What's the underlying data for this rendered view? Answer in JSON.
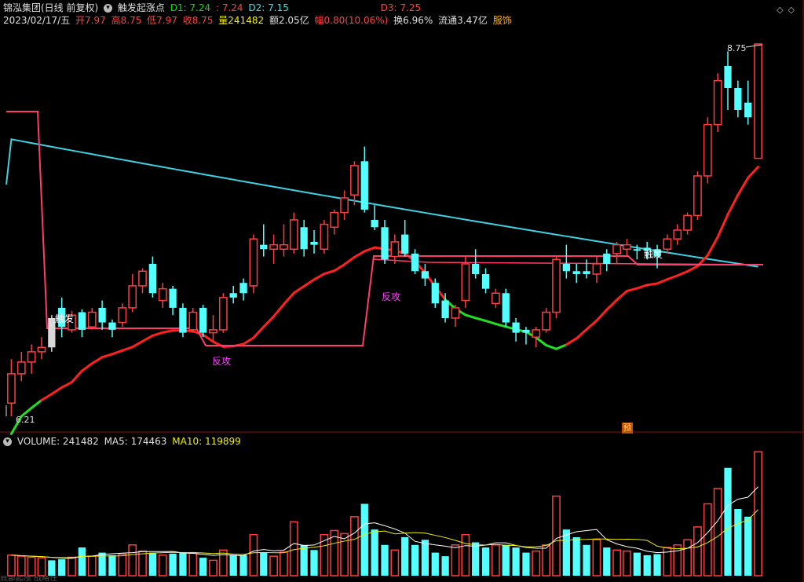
{
  "header": {
    "stock_name": "锦泓集团(日线 前复权)",
    "indicator_name": "触发起涨点",
    "d1_label": "D1: 7.24",
    "d1_extra": ": 7.24",
    "d2_label": "D2: 7.15",
    "d3_label": "D3: 7.25"
  },
  "quote": {
    "date": "2023/02/17/五",
    "open": "开7.97",
    "high": "高8.75",
    "low": "低7.97",
    "close": "收8.75",
    "volume": "量241482",
    "amount": "额2.05亿",
    "change": "幅0.80(10.06%)",
    "turnover": "换6.96%",
    "float": "流通3.47亿",
    "sector": "服饰"
  },
  "volume_header": {
    "label": "VOLUME: 241482",
    "ma5": "MA5: 174463",
    "ma10": "MA10: 119899"
  },
  "chart_labels": {
    "price_high": "8.75",
    "price_low": "6.21",
    "trigger1": "触发",
    "trigger2": "触发",
    "rebound1": "反攻",
    "rebound2": "反攻",
    "forecast_badge": "预"
  },
  "bottom_cut_text": "底部起涨 战略性",
  "colors": {
    "up": "#ff3c3c",
    "down": "#54ffff",
    "ma_long": "#40d0e0",
    "support_red": "#ff2020",
    "support_green": "#20e020",
    "trigger_line": "#ff3c6c",
    "vol_ma5": "#ffffff",
    "vol_ma10": "#f0f000"
  },
  "chart_data": {
    "type": "candlestick",
    "dates_shown": [
      "2023/02/17"
    ],
    "price_range": [
      6.21,
      8.75
    ],
    "candles": [
      {
        "o": 6.3,
        "h": 6.6,
        "l": 6.21,
        "c": 6.5,
        "up": true
      },
      {
        "o": 6.5,
        "h": 6.65,
        "l": 6.45,
        "c": 6.58,
        "up": true
      },
      {
        "o": 6.58,
        "h": 6.7,
        "l": 6.5,
        "c": 6.65,
        "up": true
      },
      {
        "o": 6.65,
        "h": 6.75,
        "l": 6.6,
        "c": 6.68,
        "up": true
      },
      {
        "o": 6.68,
        "h": 6.9,
        "l": 6.65,
        "c": 6.88,
        "up": false,
        "special": true
      },
      {
        "o": 6.95,
        "h": 7.02,
        "l": 6.75,
        "c": 6.82,
        "up": false
      },
      {
        "o": 6.8,
        "h": 6.93,
        "l": 6.78,
        "c": 6.9,
        "up": true
      },
      {
        "o": 6.92,
        "h": 6.94,
        "l": 6.75,
        "c": 6.8,
        "up": false
      },
      {
        "o": 6.82,
        "h": 6.95,
        "l": 6.8,
        "c": 6.92,
        "up": true
      },
      {
        "o": 6.95,
        "h": 7.0,
        "l": 6.8,
        "c": 6.85,
        "up": false
      },
      {
        "o": 6.85,
        "h": 6.87,
        "l": 6.75,
        "c": 6.8,
        "up": false
      },
      {
        "o": 6.85,
        "h": 6.98,
        "l": 6.82,
        "c": 6.95,
        "up": true
      },
      {
        "o": 6.95,
        "h": 7.18,
        "l": 6.92,
        "c": 7.1,
        "up": true
      },
      {
        "o": 7.1,
        "h": 7.22,
        "l": 7.05,
        "c": 7.2,
        "up": true
      },
      {
        "o": 7.25,
        "h": 7.3,
        "l": 7.02,
        "c": 7.05,
        "up": false
      },
      {
        "o": 7.0,
        "h": 7.12,
        "l": 6.95,
        "c": 7.08,
        "up": true
      },
      {
        "o": 7.08,
        "h": 7.1,
        "l": 6.9,
        "c": 6.95,
        "up": false
      },
      {
        "o": 6.95,
        "h": 6.98,
        "l": 6.75,
        "c": 6.78,
        "up": false
      },
      {
        "o": 6.8,
        "h": 6.95,
        "l": 6.78,
        "c": 6.92,
        "up": true
      },
      {
        "o": 6.95,
        "h": 6.97,
        "l": 6.75,
        "c": 6.78,
        "up": false
      },
      {
        "o": 6.78,
        "h": 6.9,
        "l": 6.72,
        "c": 6.8,
        "up": true
      },
      {
        "o": 6.8,
        "h": 7.05,
        "l": 6.78,
        "c": 7.02,
        "up": true
      },
      {
        "o": 7.02,
        "h": 7.1,
        "l": 6.98,
        "c": 7.05,
        "up": false
      },
      {
        "o": 7.05,
        "h": 7.15,
        "l": 7.0,
        "c": 7.12,
        "up": false
      },
      {
        "o": 7.1,
        "h": 7.45,
        "l": 7.05,
        "c": 7.42,
        "up": true
      },
      {
        "o": 7.38,
        "h": 7.52,
        "l": 7.3,
        "c": 7.35,
        "up": false
      },
      {
        "o": 7.35,
        "h": 7.45,
        "l": 7.25,
        "c": 7.38,
        "up": true
      },
      {
        "o": 7.38,
        "h": 7.52,
        "l": 7.3,
        "c": 7.35,
        "up": true
      },
      {
        "o": 7.35,
        "h": 7.6,
        "l": 7.32,
        "c": 7.55,
        "up": true
      },
      {
        "o": 7.5,
        "h": 7.55,
        "l": 7.3,
        "c": 7.35,
        "up": false
      },
      {
        "o": 7.4,
        "h": 7.48,
        "l": 7.32,
        "c": 7.38,
        "up": false
      },
      {
        "o": 7.35,
        "h": 7.55,
        "l": 7.32,
        "c": 7.52,
        "up": true
      },
      {
        "o": 7.5,
        "h": 7.62,
        "l": 7.45,
        "c": 7.6,
        "up": true
      },
      {
        "o": 7.6,
        "h": 7.75,
        "l": 7.55,
        "c": 7.7,
        "up": true
      },
      {
        "o": 7.72,
        "h": 7.95,
        "l": 7.65,
        "c": 7.92,
        "up": true
      },
      {
        "o": 7.95,
        "h": 8.05,
        "l": 7.6,
        "c": 7.62,
        "up": false
      },
      {
        "o": 7.55,
        "h": 7.65,
        "l": 7.48,
        "c": 7.5,
        "up": false
      },
      {
        "o": 7.5,
        "h": 7.55,
        "l": 7.25,
        "c": 7.28,
        "up": false
      },
      {
        "o": 7.3,
        "h": 7.45,
        "l": 7.25,
        "c": 7.4,
        "up": true
      },
      {
        "o": 7.45,
        "h": 7.55,
        "l": 7.3,
        "c": 7.32,
        "up": false
      },
      {
        "o": 7.32,
        "h": 7.35,
        "l": 7.18,
        "c": 7.2,
        "up": false
      },
      {
        "o": 7.2,
        "h": 7.25,
        "l": 7.1,
        "c": 7.15,
        "up": false
      },
      {
        "o": 7.12,
        "h": 7.15,
        "l": 6.95,
        "c": 6.98,
        "up": false
      },
      {
        "o": 7.0,
        "h": 7.05,
        "l": 6.85,
        "c": 6.88,
        "up": false
      },
      {
        "o": 6.88,
        "h": 6.97,
        "l": 6.82,
        "c": 6.95,
        "up": true
      },
      {
        "o": 7.0,
        "h": 7.3,
        "l": 6.95,
        "c": 7.25,
        "up": true
      },
      {
        "o": 7.25,
        "h": 7.35,
        "l": 7.15,
        "c": 7.18,
        "up": false
      },
      {
        "o": 7.18,
        "h": 7.22,
        "l": 7.05,
        "c": 7.08,
        "up": false
      },
      {
        "o": 7.05,
        "h": 7.08,
        "l": 6.95,
        "c": 6.98,
        "up": true
      },
      {
        "o": 7.05,
        "h": 7.08,
        "l": 6.82,
        "c": 6.85,
        "up": false
      },
      {
        "o": 6.85,
        "h": 6.88,
        "l": 6.72,
        "c": 6.78,
        "up": false
      },
      {
        "o": 6.78,
        "h": 6.82,
        "l": 6.7,
        "c": 6.8,
        "up": false
      },
      {
        "o": 6.75,
        "h": 6.82,
        "l": 6.68,
        "c": 6.8,
        "up": true
      },
      {
        "o": 6.8,
        "h": 6.95,
        "l": 6.78,
        "c": 6.92,
        "up": true
      },
      {
        "o": 6.92,
        "h": 7.3,
        "l": 6.88,
        "c": 7.28,
        "up": true
      },
      {
        "o": 7.25,
        "h": 7.38,
        "l": 7.15,
        "c": 7.2,
        "up": false
      },
      {
        "o": 7.18,
        "h": 7.25,
        "l": 7.12,
        "c": 7.2,
        "up": false
      },
      {
        "o": 7.2,
        "h": 7.28,
        "l": 7.15,
        "c": 7.18,
        "up": false
      },
      {
        "o": 7.18,
        "h": 7.3,
        "l": 7.12,
        "c": 7.25,
        "up": true
      },
      {
        "o": 7.25,
        "h": 7.35,
        "l": 7.2,
        "c": 7.32,
        "up": false
      },
      {
        "o": 7.32,
        "h": 7.4,
        "l": 7.25,
        "c": 7.38,
        "up": true
      },
      {
        "o": 7.38,
        "h": 7.42,
        "l": 7.3,
        "c": 7.35,
        "up": true
      },
      {
        "o": 7.35,
        "h": 7.38,
        "l": 7.28,
        "c": 7.34,
        "up": false
      },
      {
        "o": 7.34,
        "h": 7.4,
        "l": 7.28,
        "c": 7.36,
        "up": false
      },
      {
        "o": 7.3,
        "h": 7.38,
        "l": 7.22,
        "c": 7.35,
        "up": false
      },
      {
        "o": 7.35,
        "h": 7.45,
        "l": 7.32,
        "c": 7.42,
        "up": true
      },
      {
        "o": 7.42,
        "h": 7.52,
        "l": 7.38,
        "c": 7.48,
        "up": true
      },
      {
        "o": 7.48,
        "h": 7.6,
        "l": 7.45,
        "c": 7.58,
        "up": true
      },
      {
        "o": 7.58,
        "h": 7.88,
        "l": 7.55,
        "c": 7.85,
        "up": true
      },
      {
        "o": 7.85,
        "h": 8.25,
        "l": 7.8,
        "c": 8.2,
        "up": true
      },
      {
        "o": 8.2,
        "h": 8.55,
        "l": 8.15,
        "c": 8.5,
        "up": true
      },
      {
        "o": 8.6,
        "h": 8.7,
        "l": 8.3,
        "c": 8.45,
        "up": false
      },
      {
        "o": 8.45,
        "h": 8.5,
        "l": 8.25,
        "c": 8.3,
        "up": false
      },
      {
        "o": 8.35,
        "h": 8.5,
        "l": 8.2,
        "c": 8.25,
        "up": false
      },
      {
        "o": 7.97,
        "h": 8.75,
        "l": 7.97,
        "c": 8.75,
        "up": true
      }
    ],
    "volumes": [
      {
        "v": 40000,
        "up": true
      },
      {
        "v": 38000,
        "up": true
      },
      {
        "v": 36000,
        "up": true
      },
      {
        "v": 35000,
        "up": true
      },
      {
        "v": 30000,
        "up": false
      },
      {
        "v": 32000,
        "up": false
      },
      {
        "v": 36000,
        "up": true
      },
      {
        "v": 55000,
        "up": false
      },
      {
        "v": 38000,
        "up": true
      },
      {
        "v": 45000,
        "up": false
      },
      {
        "v": 40000,
        "up": false
      },
      {
        "v": 42000,
        "up": true
      },
      {
        "v": 60000,
        "up": true
      },
      {
        "v": 48000,
        "up": true
      },
      {
        "v": 45000,
        "up": false
      },
      {
        "v": 40000,
        "up": true
      },
      {
        "v": 43000,
        "up": false
      },
      {
        "v": 46000,
        "up": false
      },
      {
        "v": 44000,
        "up": true
      },
      {
        "v": 35000,
        "up": false
      },
      {
        "v": 30000,
        "up": true
      },
      {
        "v": 50000,
        "up": true
      },
      {
        "v": 40000,
        "up": false
      },
      {
        "v": 40000,
        "up": false
      },
      {
        "v": 80000,
        "up": true
      },
      {
        "v": 45000,
        "up": false
      },
      {
        "v": 38000,
        "up": true
      },
      {
        "v": 46000,
        "up": true
      },
      {
        "v": 105000,
        "up": true
      },
      {
        "v": 60000,
        "up": false
      },
      {
        "v": 50000,
        "up": false
      },
      {
        "v": 80000,
        "up": true
      },
      {
        "v": 88000,
        "up": true
      },
      {
        "v": 82000,
        "up": true
      },
      {
        "v": 115000,
        "up": true
      },
      {
        "v": 140000,
        "up": false
      },
      {
        "v": 90000,
        "up": false
      },
      {
        "v": 60000,
        "up": false
      },
      {
        "v": 50000,
        "up": true
      },
      {
        "v": 75000,
        "up": false
      },
      {
        "v": 60000,
        "up": false
      },
      {
        "v": 70000,
        "up": false
      },
      {
        "v": 45000,
        "up": false
      },
      {
        "v": 38000,
        "up": false
      },
      {
        "v": 60000,
        "up": true
      },
      {
        "v": 80000,
        "up": true
      },
      {
        "v": 65000,
        "up": false
      },
      {
        "v": 55000,
        "up": false
      },
      {
        "v": 60000,
        "up": true
      },
      {
        "v": 60000,
        "up": false
      },
      {
        "v": 55000,
        "up": false
      },
      {
        "v": 45000,
        "up": false
      },
      {
        "v": 48000,
        "up": true
      },
      {
        "v": 60000,
        "up": true
      },
      {
        "v": 155000,
        "up": true
      },
      {
        "v": 90000,
        "up": false
      },
      {
        "v": 75000,
        "up": false
      },
      {
        "v": 60000,
        "up": false
      },
      {
        "v": 70000,
        "up": true
      },
      {
        "v": 55000,
        "up": false
      },
      {
        "v": 50000,
        "up": true
      },
      {
        "v": 48000,
        "up": true
      },
      {
        "v": 45000,
        "up": false
      },
      {
        "v": 40000,
        "up": false
      },
      {
        "v": 42000,
        "up": false
      },
      {
        "v": 55000,
        "up": true
      },
      {
        "v": 60000,
        "up": true
      },
      {
        "v": 70000,
        "up": true
      },
      {
        "v": 95000,
        "up": true
      },
      {
        "v": 140000,
        "up": true
      },
      {
        "v": 170000,
        "up": true
      },
      {
        "v": 210000,
        "up": false
      },
      {
        "v": 130000,
        "up": false
      },
      {
        "v": 115000,
        "up": false
      },
      {
        "v": 241482,
        "up": true
      }
    ]
  }
}
